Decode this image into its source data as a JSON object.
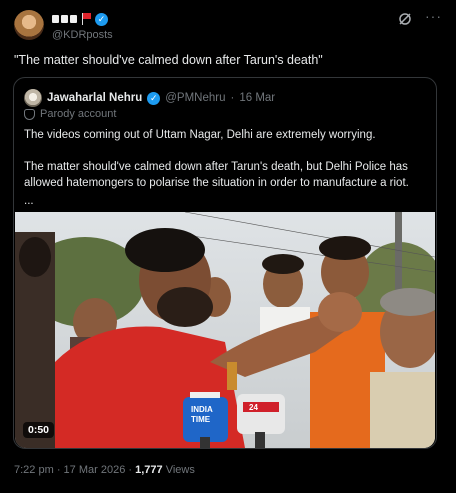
{
  "post": {
    "author_name_glyphs": "■■■",
    "handle": "@KDRposts",
    "text": "\"The matter should've calmed down after Tarun's death\"",
    "time": "7:22 pm",
    "separator": "·",
    "date": "17 Mar 2026",
    "views_count": "1,777",
    "views_label": "Views",
    "more_label": "···",
    "verified_mark": "✓"
  },
  "quote": {
    "name": "Jawaharlal Nehru",
    "handle": "@PMNehru",
    "date": "16 Mar",
    "separator": "·",
    "parody_label": "Parody account",
    "paragraph1": "The videos coming out of Uttam Nagar, Delhi are extremely worrying.",
    "paragraph2": "The matter should've calmed down after Tarun's death, but Delhi Police has allowed hatemongers to polarise the situation in order to manufacture a riot.",
    "ellipsis": "...",
    "video_duration": "0:50",
    "mic_label_1": "INDIA",
    "mic_label_2": "TIME",
    "mic_label_3": "24",
    "verified_mark": "✓"
  },
  "colors": {
    "background": "#000000",
    "text": "#e7e9ea",
    "secondary": "#71767b",
    "verified": "#1d9bf0",
    "border": "#333639",
    "flag": "#e0242c"
  },
  "icons": [
    "avatar",
    "flag-icon",
    "verified-badge-icon",
    "grok-icon",
    "more-icon",
    "parody-mask-icon"
  ]
}
